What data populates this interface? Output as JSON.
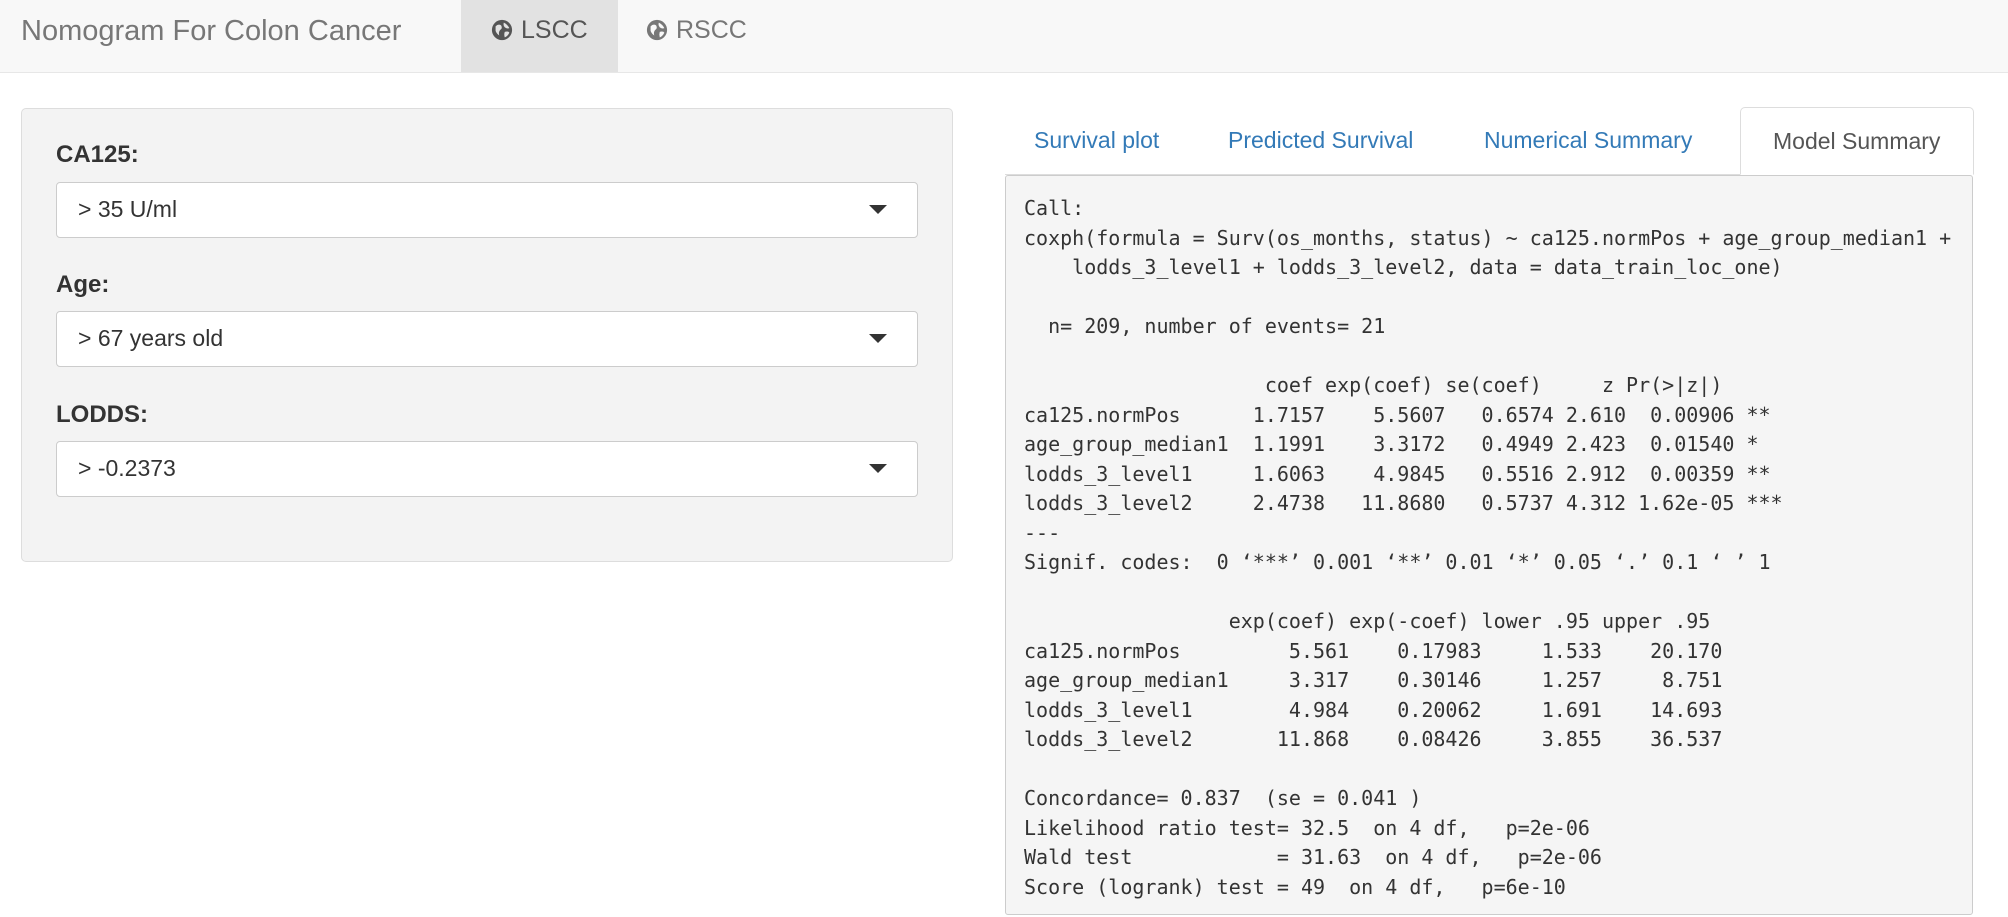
{
  "navbar": {
    "title": "Nomogram For Colon Cancer",
    "tabs": [
      {
        "label": "LSCC",
        "icon": "globe-icon",
        "active": true
      },
      {
        "label": "RSCC",
        "icon": "globe-icon",
        "active": false
      }
    ]
  },
  "sidebar": {
    "ca125": {
      "label": "CA125:",
      "value": "> 35 U/ml"
    },
    "age": {
      "label": "Age:",
      "value": "> 67 years old"
    },
    "lodds": {
      "label": "LODDS:",
      "value": "> -0.2373"
    }
  },
  "main": {
    "tabs": [
      {
        "label": "Survival plot",
        "active": false
      },
      {
        "label": "Predicted Survival",
        "active": false
      },
      {
        "label": "Numerical Summary",
        "active": false
      },
      {
        "label": "Model Summary",
        "active": true
      }
    ],
    "output_lines": [
      "Call:",
      "coxph(formula = Surv(os_months, status) ~ ca125.normPos + age_group_median1 +",
      "    lodds_3_level1 + lodds_3_level2, data = data_train_loc_one)",
      "",
      "  n= 209, number of events= 21",
      "",
      "                    coef exp(coef) se(coef)     z Pr(>|z|)",
      "ca125.normPos      1.7157    5.5607   0.6574 2.610  0.00906 **",
      "age_group_median1  1.1991    3.3172   0.4949 2.423  0.01540 *",
      "lodds_3_level1     1.6063    4.9845   0.5516 2.912  0.00359 **",
      "lodds_3_level2     2.4738   11.8680   0.5737 4.312 1.62e-05 ***",
      "---",
      "Signif. codes:  0 ‘***’ 0.001 ‘**’ 0.01 ‘*’ 0.05 ‘.’ 0.1 ‘ ’ 1",
      "",
      "                 exp(coef) exp(-coef) lower .95 upper .95",
      "ca125.normPos         5.561    0.17983     1.533    20.170",
      "age_group_median1     3.317    0.30146     1.257     8.751",
      "lodds_3_level1        4.984    0.20062     1.691    14.693",
      "lodds_3_level2       11.868    0.08426     3.855    36.537",
      "",
      "Concordance= 0.837  (se = 0.041 )",
      "Likelihood ratio test= 32.5  on 4 df,   p=2e-06",
      "Wald test            = 31.63  on 4 df,   p=2e-06",
      "Score (logrank) test = 49  on 4 df,   p=6e-10"
    ]
  },
  "colors": {
    "link": "#337ab7",
    "navbar_bg": "#f8f8f8",
    "active_nav_bg": "#e2e2e2",
    "panel_bg": "#f3f3f3",
    "output_bg": "#f5f5f5"
  }
}
